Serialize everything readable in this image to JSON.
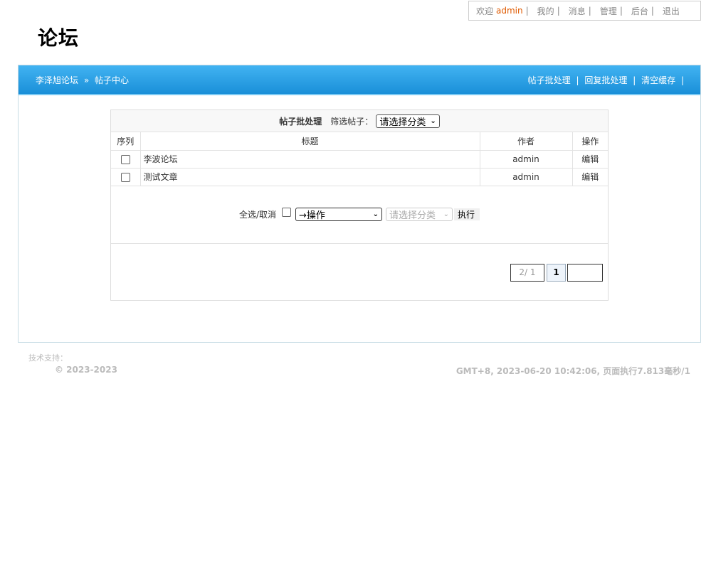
{
  "topbar": {
    "welcome": "欢迎",
    "username": "admin",
    "links": [
      "我的",
      "消息",
      "管理",
      "后台",
      "退出"
    ]
  },
  "logo": {
    "text": "论坛"
  },
  "panel": {
    "breadcrumb": {
      "home": "李泽旭论坛",
      "arrow": "»",
      "current": "帖子中心"
    },
    "actions": [
      "帖子批处理",
      "回复批处理",
      "清空缓存"
    ]
  },
  "batch": {
    "title": "帖子批处理",
    "filter_label": "筛选帖子：",
    "filter_value": "请选择分类",
    "columns": [
      "序列",
      "标题",
      "作者",
      "操作"
    ],
    "rows": [
      {
        "title": "李波论坛",
        "author": "admin",
        "action": "编辑"
      },
      {
        "title": "测试文章",
        "author": "admin",
        "action": "编辑"
      }
    ],
    "select_all_label": "全选/取消",
    "operation_value": "→操作",
    "category_value": "请选择分类",
    "execute_label": "执行"
  },
  "pagination": {
    "info": "2/ 1",
    "current": "1",
    "next": ""
  },
  "footer": {
    "support": "技术支持：",
    "copyright": "© 2023-2023",
    "status": "GMT+8, 2023-06-20 10:42:06, 页面执行7.813毫秒/1"
  }
}
